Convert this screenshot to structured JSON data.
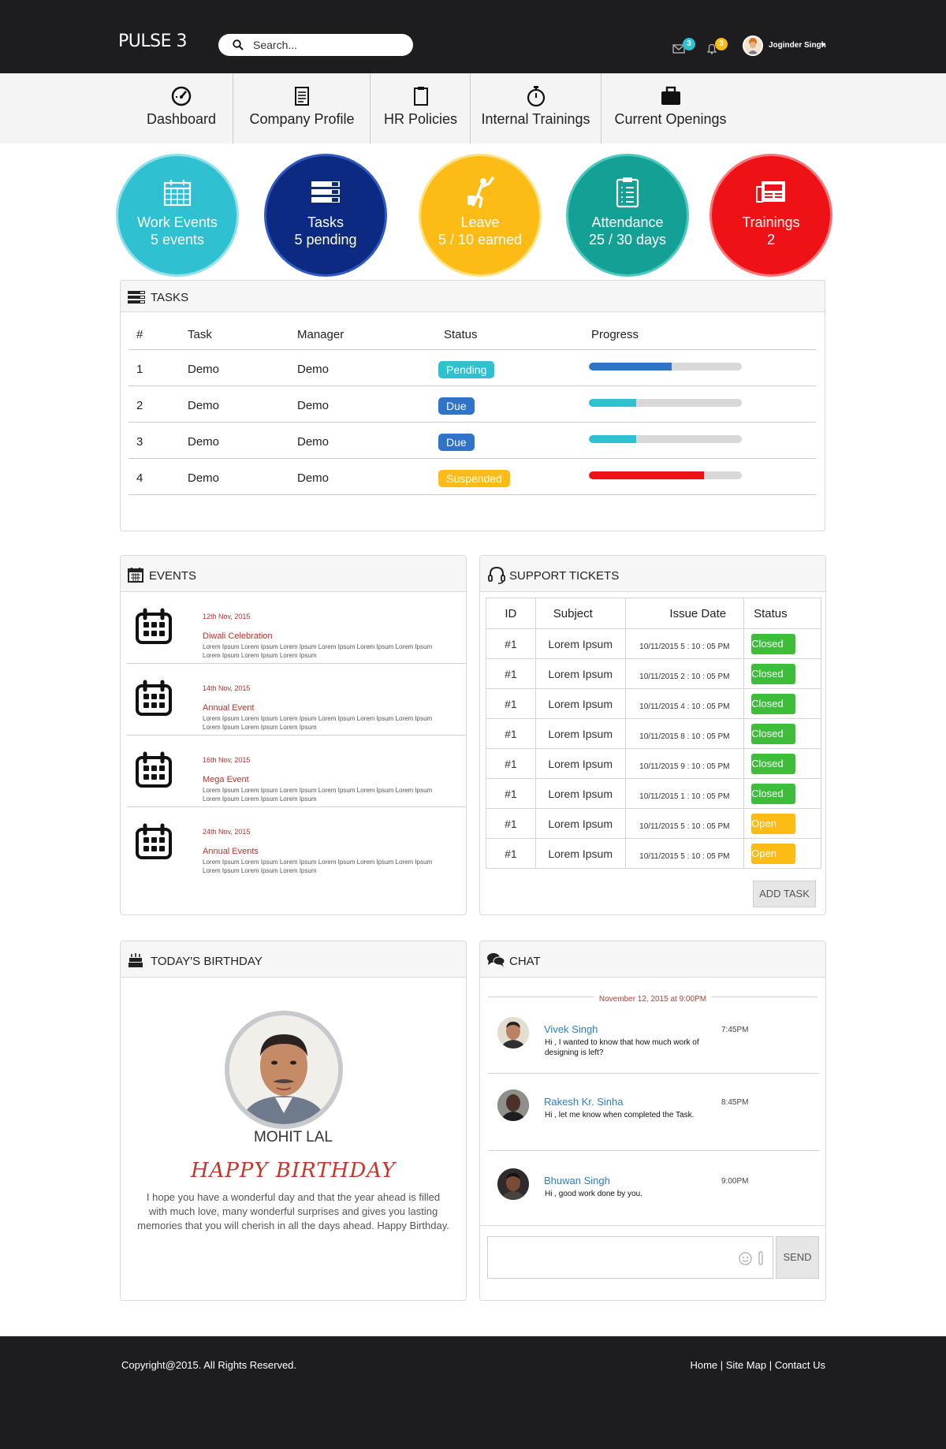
{
  "app": {
    "logo": "PULSE 3"
  },
  "header": {
    "search_placeholder": "Search...",
    "mail_count": "3",
    "notif_count": "3",
    "user_name": "Joginder Singh"
  },
  "nav": {
    "items": [
      {
        "label": "Dashboard",
        "icon": "speedometer-icon"
      },
      {
        "label": "Company Profile",
        "icon": "document-icon"
      },
      {
        "label": "HR Policies",
        "icon": "clipboard-icon"
      },
      {
        "label": "Internal Trainings",
        "icon": "stopwatch-icon"
      },
      {
        "label": "Current Openings",
        "icon": "briefcase-icon"
      }
    ]
  },
  "stats": [
    {
      "title": "Work Events",
      "sub": "5 events",
      "color": "#2fc0d2",
      "icon": "calendar-icon"
    },
    {
      "title": "Tasks",
      "sub": "5 pending",
      "color": "#0c2a82",
      "icon": "tasks-icon"
    },
    {
      "title": "Leave",
      "sub": "5 / 10 earned",
      "color": "#fdbb16",
      "icon": "traveler-icon"
    },
    {
      "title": "Attendance",
      "sub": "25 / 30 days",
      "color": "#15a096",
      "icon": "checklist-icon"
    },
    {
      "title": "Trainings",
      "sub": "2",
      "color": "#ee1116",
      "icon": "newspaper-icon"
    }
  ],
  "tasks": {
    "title": "TASKS",
    "headers": [
      "#",
      "Task",
      "Manager",
      "Status",
      "Progress"
    ],
    "rows": [
      {
        "num": "1",
        "task": "Demo",
        "manager": "Demo",
        "status": "Pending",
        "status_color": "#2fc0d2",
        "progress": 0.54,
        "bar_color": "#2f74c9"
      },
      {
        "num": "2",
        "task": "Demo",
        "manager": "Demo",
        "status": "Due",
        "status_color": "#2f74c9",
        "progress": 0.31,
        "bar_color": "#2fc0d2"
      },
      {
        "num": "3",
        "task": "Demo",
        "manager": "Demo",
        "status": "Due",
        "status_color": "#2f74c9",
        "progress": 0.31,
        "bar_color": "#2fc0d2"
      },
      {
        "num": "4",
        "task": "Demo",
        "manager": "Demo",
        "status": "Suspended",
        "status_color": "#fdbb16",
        "progress": 0.75,
        "bar_color": "#ee1116"
      }
    ]
  },
  "events": {
    "title": "EVENTS",
    "items": [
      {
        "date": "12th Nov, 2015",
        "title": "Diwali Celebration",
        "desc": "Lorem Ipsum Lorem Ipsum Lorem Ipsum Lorem Ipsum Lorem Ipsum Lorem Ipsum Lorem Ipsum Lorem Ipsum Lorem Ipsum"
      },
      {
        "date": "14th Nov, 2015",
        "title": "Annual Event",
        "desc": "Lorem Ipsum Lorem Ipsum Lorem Ipsum Lorem Ipsum Lorem Ipsum Lorem Ipsum Lorem Ipsum Lorem Ipsum Lorem Ipsum"
      },
      {
        "date": "16th Nov, 2015",
        "title": "Mega Event",
        "desc": "Lorem Ipsum Lorem Ipsum Lorem Ipsum Lorem Ipsum Lorem Ipsum Lorem Ipsum Lorem Ipsum Lorem Ipsum Lorem Ipsum"
      },
      {
        "date": "24th Nov, 2015",
        "title": "Annual Events",
        "desc": "Lorem Ipsum Lorem Ipsum Lorem Ipsum Lorem Ipsum Lorem Ipsum Lorem Ipsum Lorem Ipsum Lorem Ipsum Lorem Ipsum"
      }
    ]
  },
  "tickets": {
    "title": "SUPPORT TICKETS",
    "headers": [
      "ID",
      "Subject",
      "Issue Date",
      "Status"
    ],
    "rows": [
      {
        "id": "#1",
        "subject": "Lorem Ipsum",
        "date": "10/11/2015  5 : 10 : 05 PM",
        "status": "Closed",
        "color": "#3dbd3a"
      },
      {
        "id": "#1",
        "subject": "Lorem Ipsum",
        "date": "10/11/2015  2 : 10 : 05 PM",
        "status": "Closed",
        "color": "#3dbd3a"
      },
      {
        "id": "#1",
        "subject": "Lorem Ipsum",
        "date": "10/11/2015  4 : 10 : 05 PM",
        "status": "Closed",
        "color": "#3dbd3a"
      },
      {
        "id": "#1",
        "subject": "Lorem Ipsum",
        "date": "10/11/2015  8 : 10 : 05 PM",
        "status": "Closed",
        "color": "#3dbd3a"
      },
      {
        "id": "#1",
        "subject": "Lorem Ipsum",
        "date": "10/11/2015  9 : 10 : 05 PM",
        "status": "Closed",
        "color": "#3dbd3a"
      },
      {
        "id": "#1",
        "subject": "Lorem Ipsum",
        "date": "10/11/2015  1 : 10 : 05 PM",
        "status": "Closed",
        "color": "#3dbd3a"
      },
      {
        "id": "#1",
        "subject": "Lorem Ipsum",
        "date": "10/11/2015  5 : 10 : 05 PM",
        "status": "Open",
        "color": "#fdbb16"
      },
      {
        "id": "#1",
        "subject": "Lorem Ipsum",
        "date": "10/11/2015  5 : 10 : 05 PM",
        "status": "Open",
        "color": "#fdbb16"
      }
    ],
    "add_label": "ADD TASK"
  },
  "birthday": {
    "title": "TODAY'S BIRTHDAY",
    "name": "MOHIT LAL",
    "greeting": "HAPPY BIRTHDAY",
    "message": "I hope you have a wonderful day and that the year ahead is filled with much love, many wonderful surprises and gives you lasting memories that you will cherish in all the days ahead. Happy Birthday."
  },
  "chat": {
    "title": "CHAT",
    "date": "November 12, 2015 at 9:00PM",
    "messages": [
      {
        "name": "Vivek Singh",
        "text": "Hi , I wanted to know that how much work of designing is left?",
        "time": "7:45PM"
      },
      {
        "name": "Rakesh Kr. Sinha",
        "text": "Hi , let me know when completed the Task.",
        "time": "8:45PM"
      },
      {
        "name": "Bhuwan Singh",
        "text": "Hi , good work done by you.",
        "time": "9:00PM"
      }
    ],
    "send_label": "SEND"
  },
  "footer": {
    "copyright": "Copyright@2015. All Rights Reserved.",
    "links": [
      "Home",
      "Site Map",
      "Contact Us"
    ],
    "separator": " | "
  }
}
